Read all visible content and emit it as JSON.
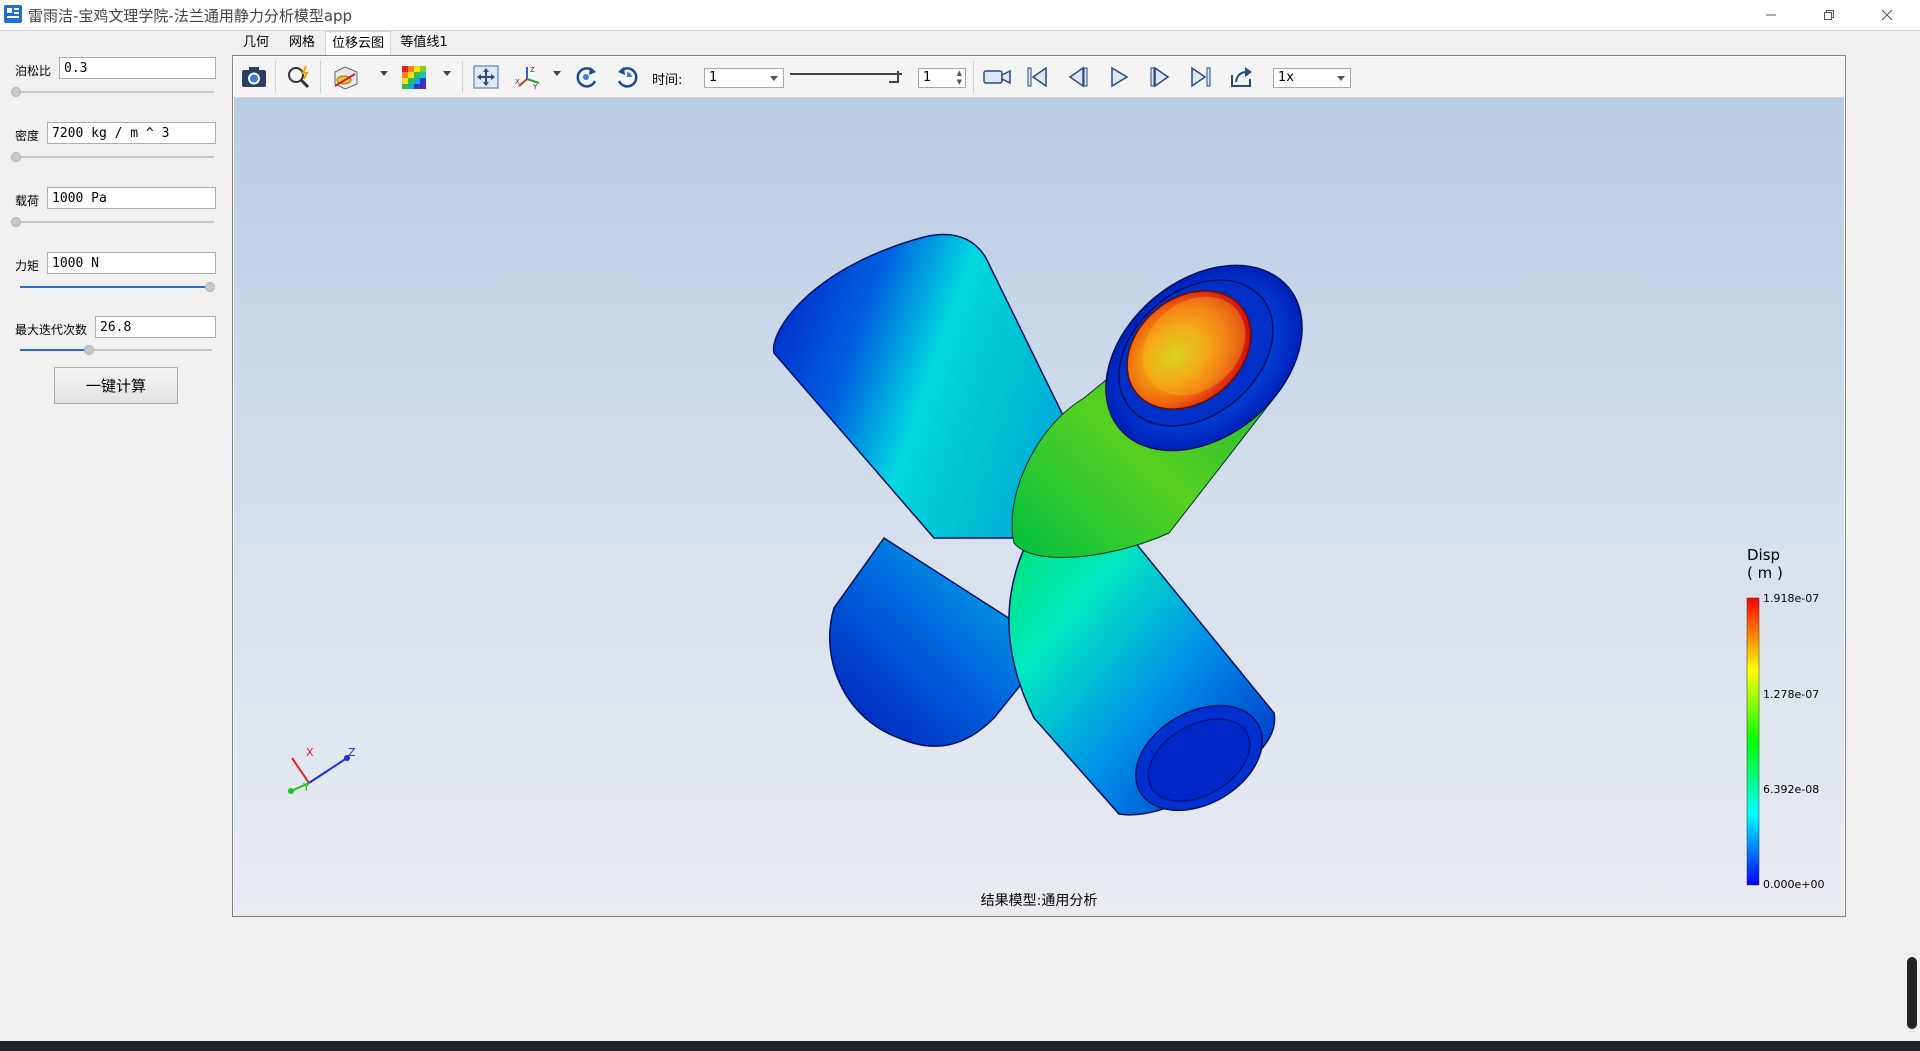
{
  "window": {
    "title": "雷雨洁-宝鸡文理学院-法兰通用静力分析模型app",
    "minimize_icon": "minimize-icon",
    "restore_icon": "restore-icon",
    "close_icon": "close-icon"
  },
  "params": {
    "poisson": {
      "label": "泊松比",
      "value": "0.3",
      "slider_fraction": 0.0
    },
    "density": {
      "label": "密度",
      "value": "7200 kg / m ^ 3",
      "slider_fraction": 0.0
    },
    "load": {
      "label": "载荷",
      "value": "1000 Pa",
      "slider_fraction": 0.0
    },
    "moment": {
      "label": "力矩",
      "value": "1000 N",
      "slider_fraction": 1.0
    },
    "max_iter": {
      "label": "最大迭代次数",
      "value": "26.8",
      "slider_fraction": 0.36
    },
    "calc_button": "一键计算"
  },
  "tabs": [
    {
      "label": "几何",
      "active": false
    },
    {
      "label": "网格",
      "active": false
    },
    {
      "label": "位移云图",
      "active": true
    },
    {
      "label": "等值线1",
      "active": false
    }
  ],
  "toolbar": {
    "time_label": "时间:",
    "time_value": "1",
    "frame_value": "1",
    "speed_value": "1x",
    "icons": [
      "camera-icon",
      "zoom-icon",
      "slice-icon",
      "color-map-icon",
      "fit-view-icon",
      "axes-icon",
      "rotate-cw-icon",
      "rotate-ccw-icon",
      "record-icon",
      "first-frame-icon",
      "prev-frame-icon",
      "play-icon",
      "next-frame-icon",
      "last-frame-icon",
      "export-icon"
    ]
  },
  "viewport": {
    "caption": "结果模型:通用分析",
    "axes": {
      "x": "X",
      "y": "Y",
      "z": "Z"
    },
    "legend": {
      "title_line1": "Disp",
      "title_line2": "( m )",
      "max": "1.918e-07",
      "mid_high": "1.278e-07",
      "mid_low": "6.392e-08",
      "min": "0.000e+00",
      "colors": [
        "#ff0000",
        "#ffff00",
        "#00ff00",
        "#00ffff",
        "#0000ff"
      ]
    }
  }
}
